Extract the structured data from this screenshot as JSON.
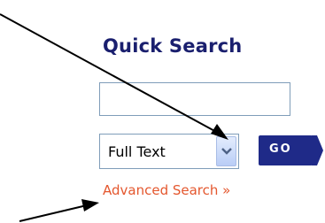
{
  "quick_search": {
    "title": "Quick Search",
    "input_value": "",
    "scope_selected": "Full Text",
    "go_label": "GO",
    "advanced_link": "Advanced Search »"
  },
  "colors": {
    "title": "#1a1f6e",
    "go_button": "#1f2a88",
    "advanced_link": "#e4572e",
    "annotation_arrow": "#000000"
  },
  "icons": {
    "dropdown": "chevron-down-icon",
    "go_arrow": "triangle-right-icon",
    "annotations": "arrow-icon"
  }
}
